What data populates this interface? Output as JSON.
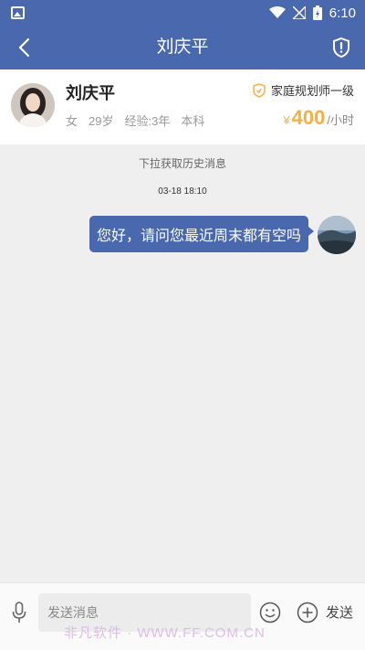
{
  "status_bar": {
    "time": "6:10"
  },
  "navbar": {
    "title": "刘庆平"
  },
  "profile": {
    "name": "刘庆平",
    "gender": "女",
    "age": "29岁",
    "experience": "经验:3年",
    "education": "本科",
    "badge": "家庭规划师一级",
    "price_currency": "¥",
    "price_amount": "400",
    "price_unit": "/小时"
  },
  "chat": {
    "history_hint": "下拉获取历史消息",
    "timestamp": "03-18 18:10",
    "messages": [
      {
        "from": "me",
        "text": "您好，请问您最近周末都有空吗"
      }
    ]
  },
  "input": {
    "placeholder": "发送消息",
    "send_label": "发送",
    "watermark": "非凡软件 · WWW.FF.COM.CN"
  },
  "colors": {
    "primary": "#4a68ad",
    "price": "#f5b041",
    "background": "#efefef"
  }
}
